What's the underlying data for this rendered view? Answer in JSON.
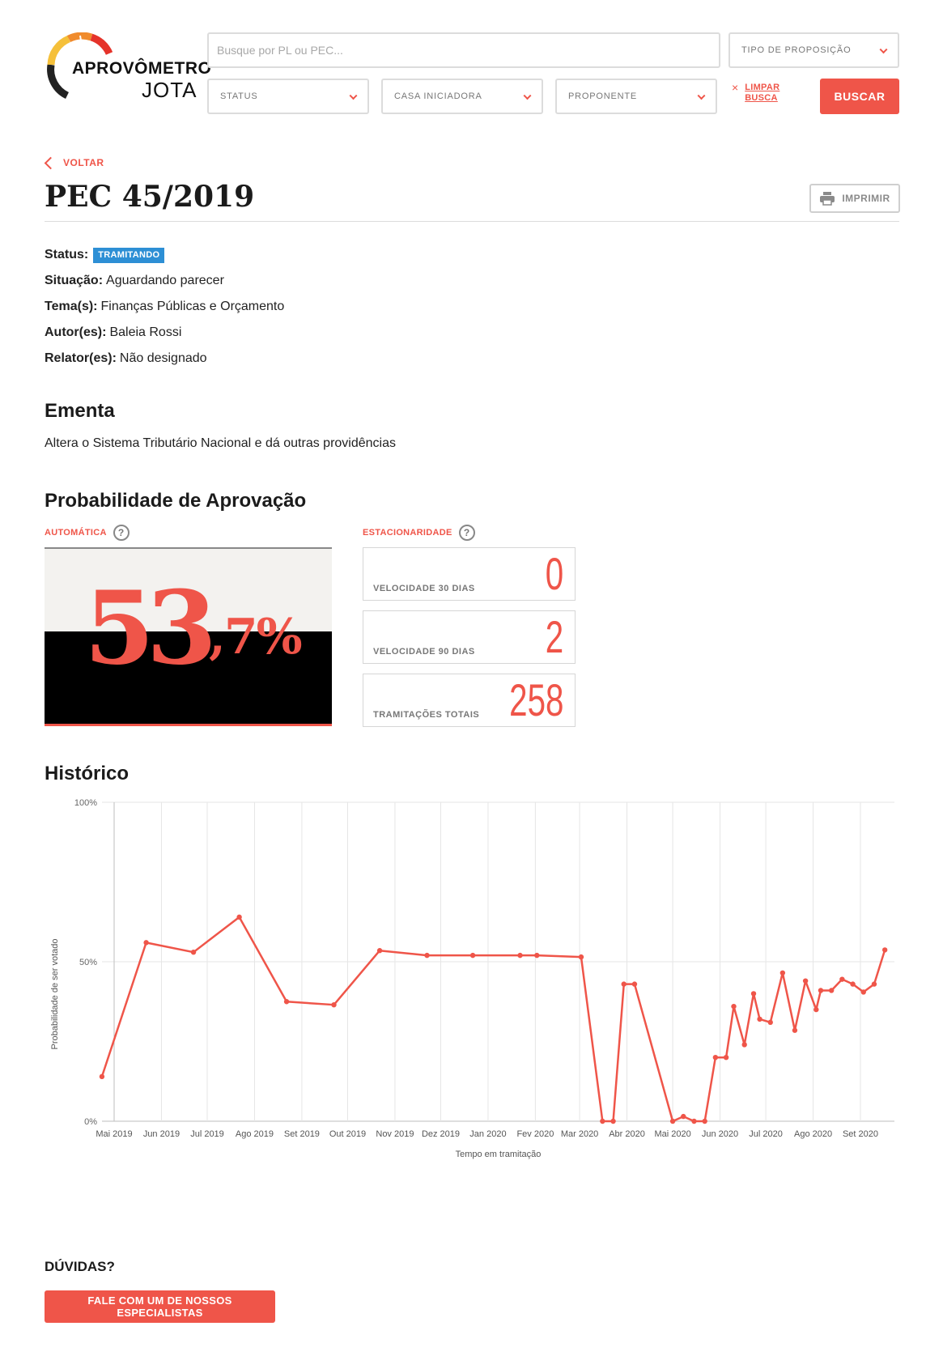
{
  "header": {
    "logo_title": "APROVÔMETRO",
    "logo_sub": "JOTA",
    "search_placeholder": "Busque por PL ou PEC...",
    "filters": {
      "tipo": "TIPO DE PROPOSIÇÃO",
      "status": "STATUS",
      "casa": "CASA INICIADORA",
      "proponente": "PROPONENTE"
    },
    "limpar_icon": "×",
    "limpar_line1": "LIMPAR",
    "limpar_line2": "BUSCA",
    "buscar_label": "BUSCAR"
  },
  "page": {
    "voltar": "VOLTAR",
    "title": "PEC 45/2019",
    "imprimir": "IMPRIMIR"
  },
  "details": {
    "status_label": "Status:",
    "status_value": "TRAMITANDO",
    "situacao_label": "Situação:",
    "situacao_value": "Aguardando parecer",
    "tema_label": "Tema(s):",
    "tema_value": "Finanças Públicas e Orçamento",
    "autor_label": "Autor(es):",
    "autor_value": "Baleia Rossi",
    "relator_label": "Relator(es):",
    "relator_value": "Não designado"
  },
  "ementa": {
    "heading": "Ementa",
    "text": "Altera o Sistema Tributário Nacional e dá outras providências"
  },
  "probabilidade": {
    "heading": "Probabilidade de Aprovação",
    "automatica_label": "AUTOMÁTICA",
    "estacionaridade_label": "ESTACIONARIDADE",
    "help_icon": "?",
    "value_main": "53",
    "value_decimal": ",7%",
    "stats": [
      {
        "label": "VELOCIDADE 30 DIAS",
        "value": "0"
      },
      {
        "label": "VELOCIDADE 90 DIAS",
        "value": "2"
      },
      {
        "label": "TRAMITAÇÕES TOTAIS",
        "value": "258"
      }
    ]
  },
  "historico": {
    "heading": "Histórico"
  },
  "chart_data": {
    "type": "line",
    "title": "",
    "xlabel": "Tempo em tramitação",
    "ylabel": "Probabilidade de ser votado",
    "ylim": [
      0,
      100
    ],
    "y_ticks": [
      "0%",
      "50%",
      "100%"
    ],
    "x_ticks": [
      "Mai 2019",
      "Jun 2019",
      "Jul 2019",
      "Ago 2019",
      "Set 2019",
      "Out 2019",
      "Nov 2019",
      "Dez 2019",
      "Jan 2020",
      "Fev 2020",
      "Mar 2020",
      "Abr 2020",
      "Mai 2020",
      "Jun 2020",
      "Jul 2020",
      "Ago 2020",
      "Set 2020"
    ],
    "x_ticks_iso": [
      "2019-05-01",
      "2019-06-01",
      "2019-07-01",
      "2019-08-01",
      "2019-09-01",
      "2019-10-01",
      "2019-11-01",
      "2019-12-01",
      "2020-01-01",
      "2020-02-01",
      "2020-03-01",
      "2020-04-01",
      "2020-05-01",
      "2020-06-01",
      "2020-07-01",
      "2020-08-01",
      "2020-09-01"
    ],
    "grid": true,
    "color": "#ef5549",
    "series": [
      {
        "points": [
          [
            "2019-04-23",
            14
          ],
          [
            "2019-05-22",
            56
          ],
          [
            "2019-06-22",
            53
          ],
          [
            "2019-07-22",
            64
          ],
          [
            "2019-08-22",
            37.5
          ],
          [
            "2019-09-22",
            36.5
          ],
          [
            "2019-10-22",
            53.5
          ],
          [
            "2019-11-22",
            52
          ],
          [
            "2019-12-22",
            52
          ],
          [
            "2020-01-22",
            52
          ],
          [
            "2020-02-02",
            52
          ],
          [
            "2020-03-02",
            51.5
          ],
          [
            "2020-03-16",
            0
          ],
          [
            "2020-03-23",
            0
          ],
          [
            "2020-03-30",
            43
          ],
          [
            "2020-04-06",
            43
          ],
          [
            "2020-05-01",
            0
          ],
          [
            "2020-05-08",
            1.5
          ],
          [
            "2020-05-15",
            0
          ],
          [
            "2020-05-22",
            0
          ],
          [
            "2020-05-29",
            20
          ],
          [
            "2020-06-05",
            20
          ],
          [
            "2020-06-10",
            36
          ],
          [
            "2020-06-17",
            24
          ],
          [
            "2020-06-23",
            40
          ],
          [
            "2020-06-27",
            32
          ],
          [
            "2020-07-04",
            31
          ],
          [
            "2020-07-12",
            46.5
          ],
          [
            "2020-07-20",
            28.5
          ],
          [
            "2020-07-27",
            44
          ],
          [
            "2020-08-03",
            35
          ],
          [
            "2020-08-06",
            41
          ],
          [
            "2020-08-13",
            41
          ],
          [
            "2020-08-20",
            44.5
          ],
          [
            "2020-08-27",
            43
          ],
          [
            "2020-09-03",
            40.5
          ],
          [
            "2020-09-10",
            43
          ],
          [
            "2020-09-17",
            53.7
          ]
        ]
      }
    ]
  },
  "duvidas": {
    "heading": "DÚVIDAS?",
    "button": "FALE COM UM DE NOSSOS ESPECIALISTAS"
  }
}
